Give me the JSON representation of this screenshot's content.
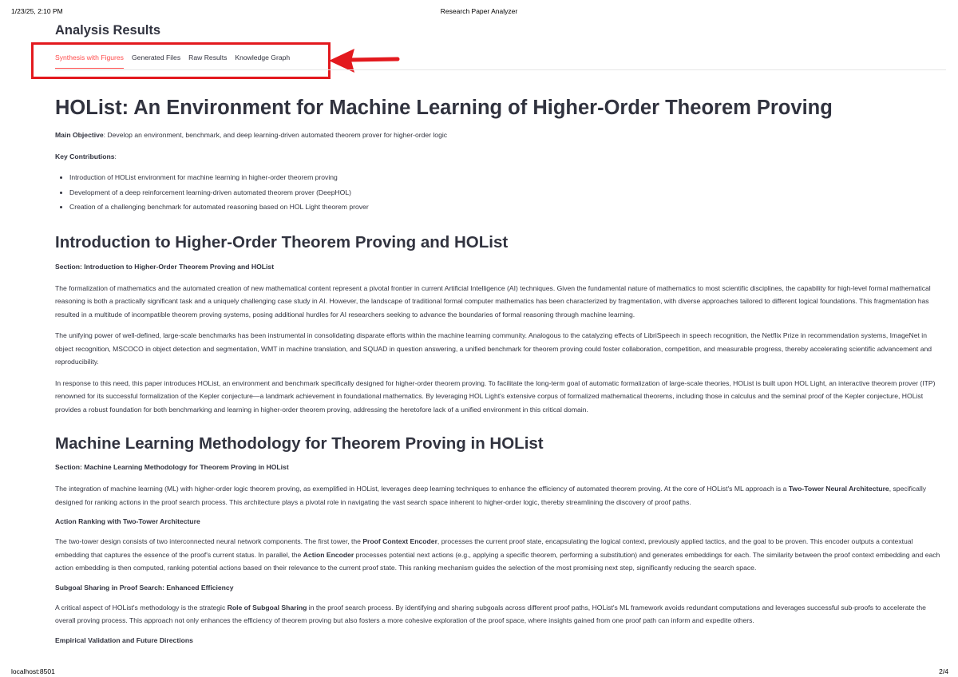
{
  "print_header": {
    "datetime": "1/23/25, 2:10 PM",
    "title": "Research Paper Analyzer"
  },
  "print_footer": {
    "url": "localhost:8501",
    "page": "2/4"
  },
  "results_title": "Analysis Results",
  "tabs": [
    {
      "label": "Synthesis with Figures",
      "active": true
    },
    {
      "label": "Generated Files",
      "active": false
    },
    {
      "label": "Raw Results",
      "active": false
    },
    {
      "label": "Knowledge Graph",
      "active": false
    }
  ],
  "annotation": {
    "color": "#e3191e"
  },
  "paper": {
    "title": "HOList: An Environment for Machine Learning of Higher-Order Theorem Proving",
    "main_objective_label": "Main Objective",
    "main_objective_text": ": Develop an environment, benchmark, and deep learning-driven automated theorem prover for higher-order logic",
    "key_contributions_label": "Key Contributions",
    "key_contributions_colon": ":",
    "contributions": [
      "Introduction of HOList environment for machine learning in higher-order theorem proving",
      "Development of a deep reinforcement learning-driven automated theorem prover (DeepHOL)",
      "Creation of a challenging benchmark for automated reasoning based on HOL Light theorem prover"
    ]
  },
  "section1": {
    "heading": "Introduction to Higher-Order Theorem Proving and HOList",
    "label": "Section: Introduction to Higher-Order Theorem Proving and HOList",
    "p1": "The formalization of mathematics and the automated creation of new mathematical content represent a pivotal frontier in current Artificial Intelligence (AI) techniques. Given the fundamental nature of mathematics to most scientific disciplines, the capability for high-level formal mathematical reasoning is both a practically significant task and a uniquely challenging case study in AI. However, the landscape of traditional formal computer mathematics has been characterized by fragmentation, with diverse approaches tailored to different logical foundations. This fragmentation has resulted in a multitude of incompatible theorem proving systems, posing additional hurdles for AI researchers seeking to advance the boundaries of formal reasoning through machine learning.",
    "p2": "The unifying power of well-defined, large-scale benchmarks has been instrumental in consolidating disparate efforts within the machine learning community. Analogous to the catalyzing effects of LibriSpeech in speech recognition, the Netflix Prize in recommendation systems, ImageNet in object recognition, MSCOCO in object detection and segmentation, WMT in machine translation, and SQUAD in question answering, a unified benchmark for theorem proving could foster collaboration, competition, and measurable progress, thereby accelerating scientific advancement and reproducibility.",
    "p3": "In response to this need, this paper introduces HOList, an environment and benchmark specifically designed for higher-order theorem proving. To facilitate the long-term goal of automatic formalization of large-scale theories, HOList is built upon HOL Light, an interactive theorem prover (ITP) renowned for its successful formalization of the Kepler conjecture—a landmark achievement in foundational mathematics. By leveraging HOL Light's extensive corpus of formalized mathematical theorems, including those in calculus and the seminal proof of the Kepler conjecture, HOList provides a robust foundation for both benchmarking and learning in higher-order theorem proving, addressing the heretofore lack of a unified environment in this critical domain."
  },
  "section2": {
    "heading": "Machine Learning Methodology for Theorem Proving in HOList",
    "label": "Section: Machine Learning Methodology for Theorem Proving in HOList",
    "p1_a": "The integration of machine learning (ML) with higher-order logic theorem proving, as exemplified in HOList, leverages deep learning techniques to enhance the efficiency of automated theorem proving. At the core of HOList's ML approach is a ",
    "p1_b": "Two-Tower Neural Architecture",
    "p1_c": ", specifically designed for ranking actions in the proof search process. This architecture plays a pivotal role in navigating the vast search space inherent to higher-order logic, thereby streamlining the discovery of proof paths.",
    "sub1": "Action Ranking with Two-Tower Architecture",
    "p2_a": "The two-tower design consists of two interconnected neural network components. The first tower, the ",
    "p2_b": "Proof Context Encoder",
    "p2_c": ", processes the current proof state, encapsulating the logical context, previously applied tactics, and the goal to be proven. This encoder outputs a contextual embedding that captures the essence of the proof's current status. In parallel, the ",
    "p2_d": "Action Encoder",
    "p2_e": " processes potential next actions (e.g., applying a specific theorem, performing a substitution) and generates embeddings for each. The similarity between the proof context embedding and each action embedding is then computed, ranking potential actions based on their relevance to the current proof state. This ranking mechanism guides the selection of the most promising next step, significantly reducing the search space.",
    "sub2": "Subgoal Sharing in Proof Search: Enhanced Efficiency",
    "p3_a": "A critical aspect of HOList's methodology is the strategic ",
    "p3_b": "Role of Subgoal Sharing",
    "p3_c": " in the proof search process. By identifying and sharing subgoals across different proof paths, HOList's ML framework avoids redundant computations and leverages successful sub-proofs to accelerate the overall proving process. This approach not only enhances the efficiency of theorem proving but also fosters a more cohesive exploration of the proof space, where insights gained from one proof path can inform and expedite others.",
    "sub3": "Empirical Validation and Future Directions"
  }
}
